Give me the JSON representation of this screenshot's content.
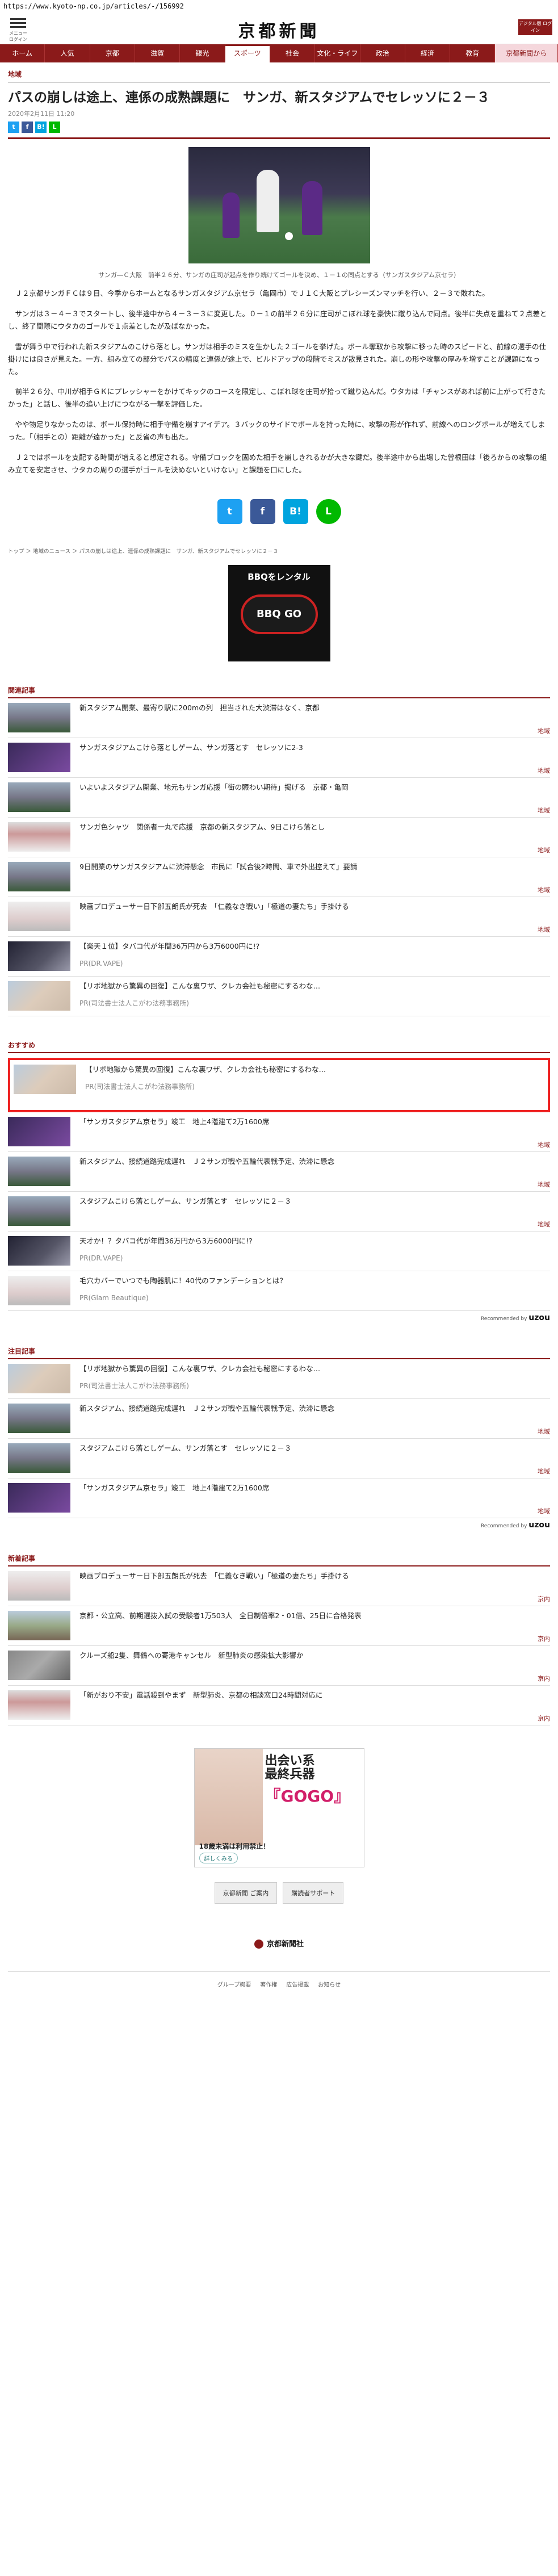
{
  "url": "https://www.kyoto-np.co.jp/articles/-/156992",
  "header": {
    "menu_label": "メニュー　ログイン",
    "logo": "京都新聞",
    "digital_label": "デジタル版 ログイン"
  },
  "nav": [
    "ホーム",
    "人気",
    "京都",
    "滋賀",
    "観光",
    "スポーツ",
    "社会",
    "文化・ライフ",
    "政治",
    "経済",
    "教育",
    "京都新聞から"
  ],
  "article": {
    "category": "地域",
    "title": "パスの崩しは途上、連係の成熟課題に　サンガ、新スタジアムでセレッソに２－３",
    "date": "2020年2月11日 11:20",
    "caption": "サンガ―Ｃ大阪　前半２６分、サンガの庄司が起点を作り続けてゴールを決め、１－１の同点とする（サンガスタジアム京セラ）",
    "paragraphs": [
      "Ｊ２京都サンガＦＣは９日、今季からホームとなるサンガスタジアム京セラ（亀岡市）でＪ１Ｃ大阪とプレシーズンマッチを行い、２－３で敗れた。",
      "サンガは３－４－３でスタートし、後半途中から４－３－３に変更した。０－１の前半２６分に庄司がこぼれ球を豪快に蹴り込んで同点。後半に失点を重ねて２点差とし、終了間際にウタカのゴールで１点差としたが及ばなかった。",
      "雪が舞う中で行われた新スタジアムのこけら落とし。サンガは相手のミスを生かした２ゴールを挙げた。ボール奪取から攻撃に移った時のスピードと、前線の選手の仕掛けには良さが見えた。一方、組み立ての部分でパスの精度と連係が途上で、ビルドアップの段階でミスが散見された。崩しの形や攻撃の厚みを増すことが課題になった。",
      "前半２６分、中川が相手ＧＫにプレッシャーをかけてキックのコースを限定し、こぼれ球を庄司が拾って蹴り込んだ。ウタカは「チャンスがあれば前に上がって行きたかった」と話し、後半の追い上げにつながる一撃を評価した。",
      "やや物足りなかったのは、ボール保持時に相手守備を崩すアイデア。３バックのサイドでボールを持った時に、攻撃の形が作れず、前線へのロングボールが増えてしまった。「（相手との）距離が遠かった」と反省の声も出た。",
      "Ｊ２ではボールを支配する時間が増えると想定される。守備ブロックを固めた相手を崩しきれるかが大きな鍵だ。後半途中から出場した曽根田は「後ろからの攻撃の組み立てを安定させ、ウタカの周りの選手がゴールを決めないといけない」と課題を口にした。"
    ],
    "breadcrumb": "トップ ＞ 地域のニュース ＞ パスの崩しは途上、連係の成熟課題に　サンガ、新スタジアムでセレッソに２－３"
  },
  "share": [
    "t",
    "f",
    "B!",
    "L"
  ],
  "ad1": {
    "title": "BBQをレンタル",
    "brand": "BBQ GO",
    "note": ""
  },
  "related": {
    "heading": "関連記事",
    "items": [
      {
        "text": "新スタジアム開業、最寄り駅に200mの列　担当された大渋滞はなく、京都",
        "tag": "地域",
        "pr": ""
      },
      {
        "text": "サンガスタジアムこけら落としゲーム、サンガ落とす　セレッソに2-3",
        "tag": "地域",
        "pr": ""
      },
      {
        "text": "いよいよスタジアム開業、地元もサンガ応援「街の賑わい期待」掲げる　京都・亀岡",
        "tag": "地域",
        "pr": ""
      },
      {
        "text": "サンガ色シャツ　関係者一丸で応援　京都の新スタジアム、9日こけら落とし",
        "tag": "地域",
        "pr": ""
      },
      {
        "text": "9日開業のサンガスタジアムに渋滞懸念　市民に「試合後2時間、車で外出控えて」要請",
        "tag": "地域",
        "pr": ""
      },
      {
        "text": "映画プロデューサー日下部五朗氏が死去　「仁義なき戦い」「極道の妻たち」手掛ける",
        "tag": "地域",
        "pr": ""
      },
      {
        "text": "【楽天１位】タバコ代が年間36万円から3万6000円に!?",
        "tag": "",
        "pr": "PR(DR.VAPE)"
      },
      {
        "text": "【リボ地獄から驚異の回復】こんな裏ワザ、クレカ会社も秘密にするわな…",
        "tag": "",
        "pr": "PR(司法書士法人こがわ法務事務所)"
      }
    ]
  },
  "recommend": {
    "heading": "おすすめ",
    "items": [
      {
        "text": "【リボ地獄から驚異の回復】こんな裏ワザ、クレカ会社も秘密にするわな…",
        "tag": "",
        "pr": "PR(司法書士法人こがわ法務事務所)"
      },
      {
        "text": "「サンガスタジアム京セラ」竣工　地上4階建て2万1600席",
        "tag": "地域",
        "pr": ""
      },
      {
        "text": "新スタジアム、接続道路完成遅れ　Ｊ２サンガ戦や五輪代表戦予定、渋滞に懸念",
        "tag": "地域",
        "pr": ""
      },
      {
        "text": "スタジアムこけら落としゲーム、サンガ落とす　セレッソに２－３",
        "tag": "地域",
        "pr": ""
      },
      {
        "text": "天才か！？タバコ代が年間36万円から3万6000円に!?",
        "tag": "",
        "pr": "PR(DR.VAPE)"
      },
      {
        "text": "毛穴カバーでいつでも陶器肌に！40代のファンデーションとは？",
        "tag": "",
        "pr": "PR(Glam Beautique)"
      }
    ],
    "powered": "Recommended by",
    "brand": "uzou"
  },
  "notice": {
    "heading": "注目記事",
    "items": [
      {
        "text": "【リボ地獄から驚異の回復】こんな裏ワザ、クレカ会社も秘密にするわな…",
        "tag": "",
        "pr": "PR(司法書士法人こがわ法務事務所)"
      },
      {
        "text": "新スタジアム、接続道路完成遅れ　Ｊ２サンガ戦や五輪代表戦予定、渋滞に懸念",
        "tag": "地域",
        "pr": ""
      },
      {
        "text": "スタジアムこけら落としゲーム、サンガ落とす　セレッソに２－３",
        "tag": "地域",
        "pr": ""
      },
      {
        "text": "「サンガスタジアム京セラ」竣工　地上4階建て2万1600席",
        "tag": "地域",
        "pr": ""
      }
    ],
    "powered": "Recommended by",
    "brand": "uzou"
  },
  "latest": {
    "heading": "新着記事",
    "items": [
      {
        "text": "映画プロデューサー日下部五朗氏が死去　「仁義なき戦い」「極道の妻たち」手掛ける",
        "tag": "京内",
        "pr": ""
      },
      {
        "text": "京都・公立高、前期選抜入試の受験者1万503人　全日制倍率2・01倍、25日に合格発表",
        "tag": "京内",
        "pr": ""
      },
      {
        "text": "クルーズ船2隻、舞鶴への寄港キャンセル　新型肺炎の感染拡大影響か",
        "tag": "京内",
        "pr": ""
      },
      {
        "text": "「新がおり不安」電話殺到やまず　新型肺炎、京都の相談窓口24時間対応に",
        "tag": "京内",
        "pr": ""
      }
    ]
  },
  "ad2": {
    "h1": "出会い系\n最終兵器",
    "h2": "『GOGO』",
    "bottom": "18歳未満は利用禁止！",
    "detail": "詳しくみる"
  },
  "buttons": [
    "京都新聞 ご案内",
    "購読者サポート"
  ],
  "footer": {
    "logo": "京都新聞社",
    "links": [
      "グループ概要",
      "著作権",
      "広告掲載",
      "お知らせ"
    ]
  }
}
